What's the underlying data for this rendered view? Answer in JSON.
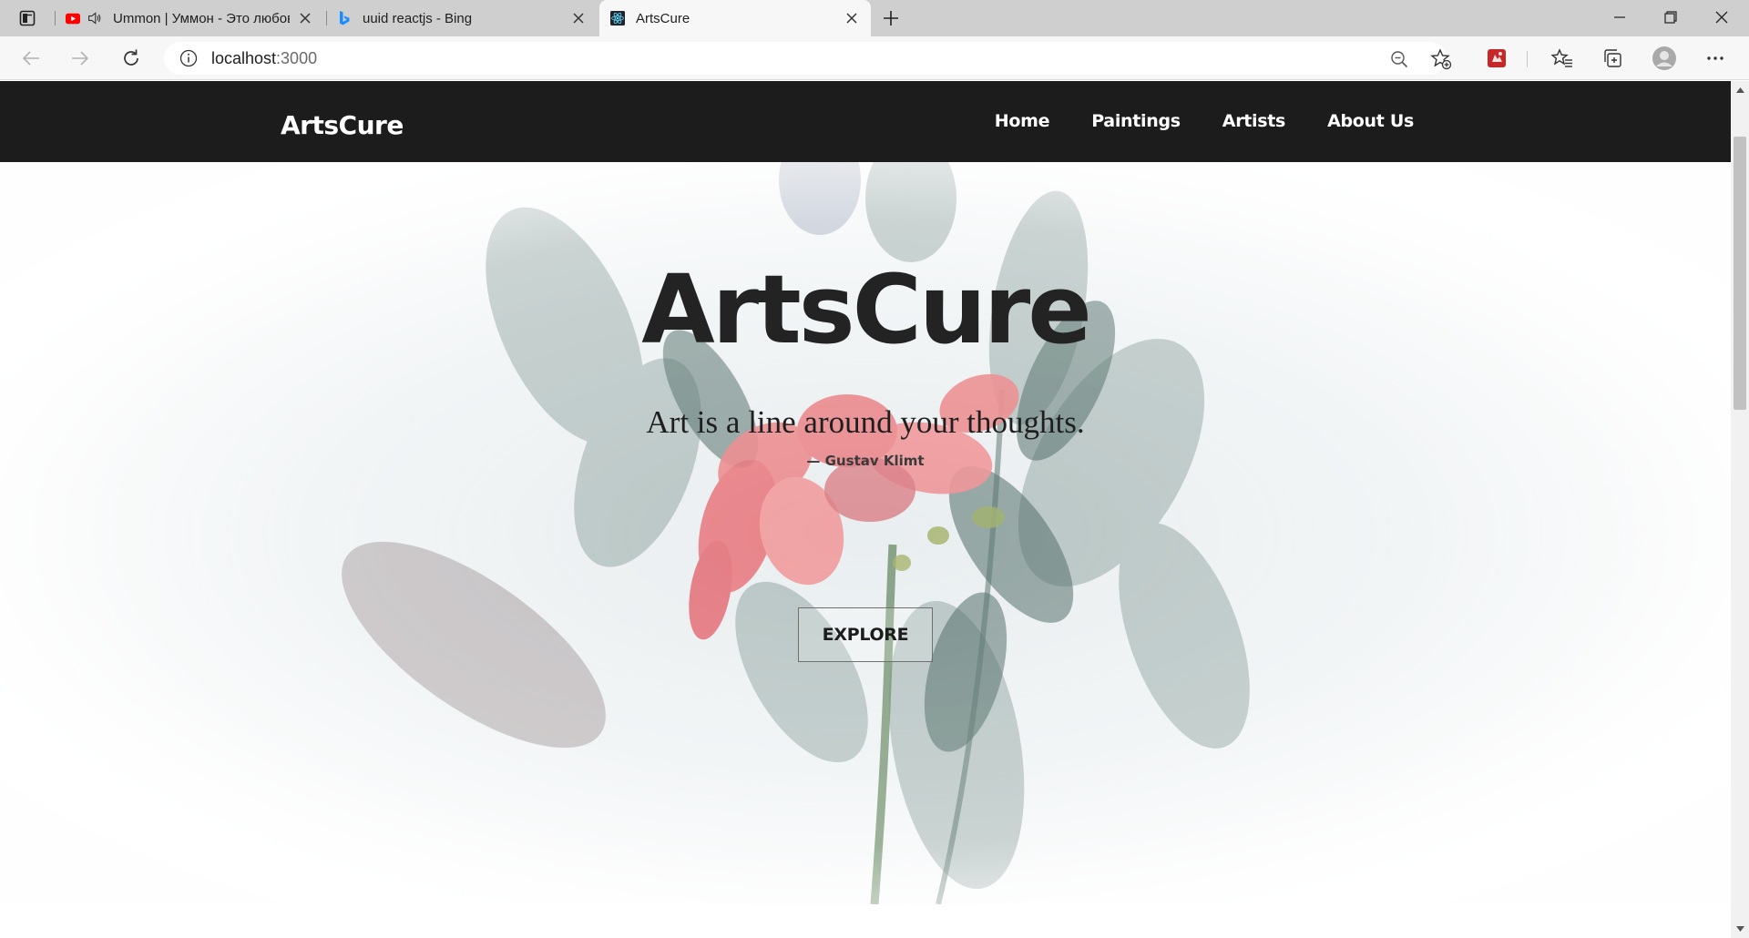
{
  "browser": {
    "tabs": [
      {
        "title": "Ummon | Уммон - Это любовь",
        "favicon": "youtube-icon",
        "audio": true,
        "active": false
      },
      {
        "title": "uuid reactjs - Bing",
        "favicon": "bing-icon",
        "audio": false,
        "active": false
      },
      {
        "title": "ArtsCure",
        "favicon": "react-icon",
        "audio": false,
        "active": true
      }
    ],
    "address": {
      "host": "localhost",
      "port": ":3000"
    }
  },
  "site": {
    "brand": "ArtsCure",
    "nav": [
      "Home",
      "Paintings",
      "Artists",
      "About Us"
    ]
  },
  "hero": {
    "title": "ArtsCure",
    "quote": "Art is a line around your thoughts.",
    "author": "— Gustav Klimt",
    "cta": "EXPLORE"
  },
  "colors": {
    "navbar": "#1c1c1c",
    "text_dark": "#232323",
    "flower_pink": "#ec8a8c",
    "foliage": "#4f6f68"
  }
}
